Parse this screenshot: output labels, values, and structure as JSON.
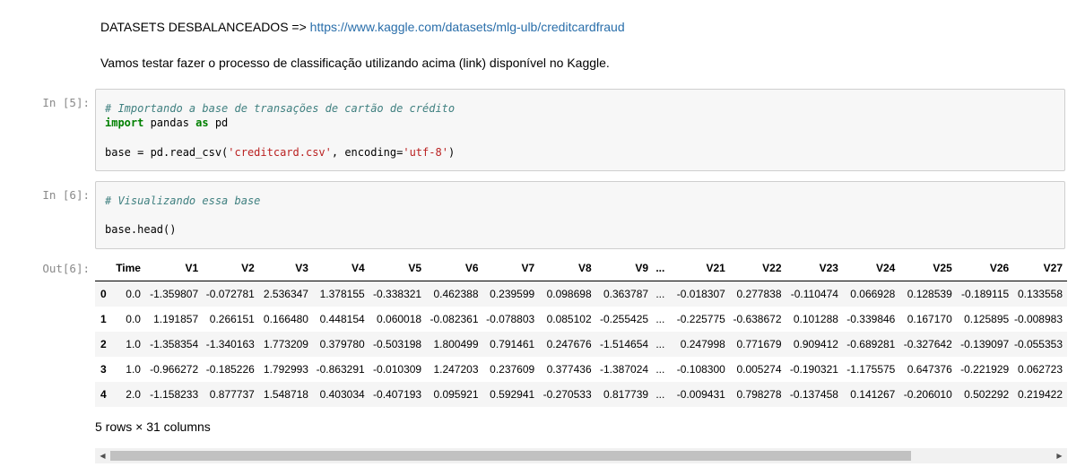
{
  "markdown": {
    "line1_prefix": "DATASETS DESBALANCEADOS => ",
    "line1_link": "https://www.kaggle.com/datasets/mlg-ulb/creditcardfraud",
    "line2": "Vamos testar fazer o processo de classificação utilizando acima (link) disponível no Kaggle."
  },
  "cells": [
    {
      "prompt": "In [5]:",
      "comment": "# Importando a base de transações de cartão de crédito",
      "import_kw": "import",
      "import_mod": " pandas ",
      "as_kw": "as",
      "import_alias": " pd",
      "assign_prefix": "base = pd.read_csv(",
      "csv_str": "'creditcard.csv'",
      "mid": ", encoding=",
      "enc_str": "'utf-8'",
      "close": ")"
    },
    {
      "prompt": "In [6]:",
      "comment": "# Visualizando essa base",
      "code": "base.head()"
    }
  ],
  "output": {
    "prompt": "Out[6]:",
    "columns": [
      "",
      "Time",
      "V1",
      "V2",
      "V3",
      "V4",
      "V5",
      "V6",
      "V7",
      "V8",
      "V9",
      "...",
      "V21",
      "V22",
      "V23",
      "V24",
      "V25",
      "V26",
      "V27"
    ],
    "rows": [
      [
        "0",
        "0.0",
        "-1.359807",
        "-0.072781",
        "2.536347",
        "1.378155",
        "-0.338321",
        "0.462388",
        "0.239599",
        "0.098698",
        "0.363787",
        "...",
        "-0.018307",
        "0.277838",
        "-0.110474",
        "0.066928",
        "0.128539",
        "-0.189115",
        "0.133558"
      ],
      [
        "1",
        "0.0",
        "1.191857",
        "0.266151",
        "0.166480",
        "0.448154",
        "0.060018",
        "-0.082361",
        "-0.078803",
        "0.085102",
        "-0.255425",
        "...",
        "-0.225775",
        "-0.638672",
        "0.101288",
        "-0.339846",
        "0.167170",
        "0.125895",
        "-0.008983"
      ],
      [
        "2",
        "1.0",
        "-1.358354",
        "-1.340163",
        "1.773209",
        "0.379780",
        "-0.503198",
        "1.800499",
        "0.791461",
        "0.247676",
        "-1.514654",
        "...",
        "0.247998",
        "0.771679",
        "0.909412",
        "-0.689281",
        "-0.327642",
        "-0.139097",
        "-0.055353"
      ],
      [
        "3",
        "1.0",
        "-0.966272",
        "-0.185226",
        "1.792993",
        "-0.863291",
        "-0.010309",
        "1.247203",
        "0.237609",
        "0.377436",
        "-1.387024",
        "...",
        "-0.108300",
        "0.005274",
        "-0.190321",
        "-1.175575",
        "0.647376",
        "-0.221929",
        "0.062723"
      ],
      [
        "4",
        "2.0",
        "-1.158233",
        "0.877737",
        "1.548718",
        "0.403034",
        "-0.407193",
        "0.095921",
        "0.592941",
        "-0.270533",
        "0.817739",
        "...",
        "-0.009431",
        "0.798278",
        "-0.137458",
        "0.141267",
        "-0.206010",
        "0.502292",
        "0.219422"
      ]
    ],
    "shape_text": "5 rows × 31 columns"
  },
  "scrollbar": {
    "left_arrow": "◀",
    "right_arrow": "▶",
    "position_fraction": 0.0,
    "visible_fraction": 0.85
  }
}
